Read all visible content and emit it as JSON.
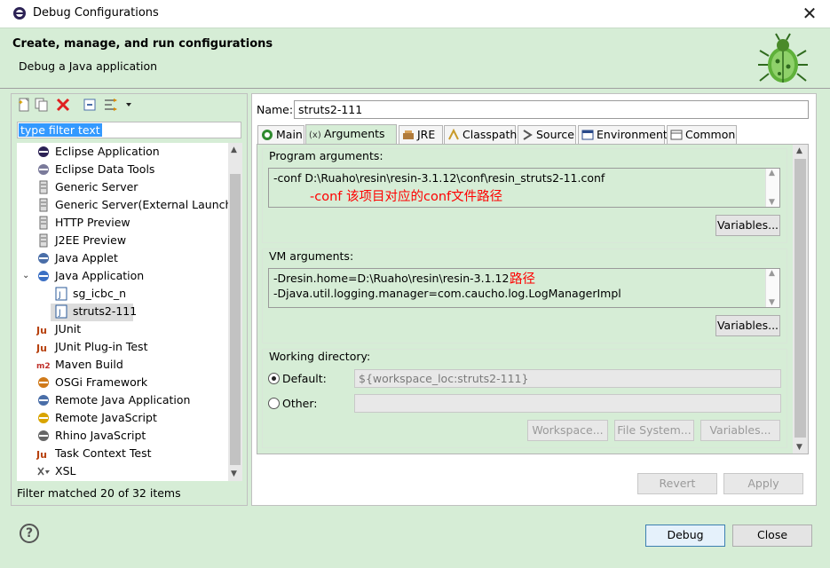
{
  "window": {
    "title": "Debug Configurations",
    "close_glyph": "✕"
  },
  "banner": {
    "title": "Create, manage, and run configurations",
    "subtitle": "Debug a Java application"
  },
  "left": {
    "filter_placeholder": "type filter text",
    "toolbar": [
      "new-config-icon",
      "duplicate-icon",
      "delete-icon",
      "collapse-all-icon",
      "filter-icon",
      "dropdown-icon"
    ],
    "tree": [
      {
        "label": "Eclipse Application",
        "icon": "eclipse-icon"
      },
      {
        "label": "Eclipse Data Tools",
        "icon": "data-tools-icon"
      },
      {
        "label": "Generic Server",
        "icon": "server-icon"
      },
      {
        "label": "Generic Server(External Launch)",
        "icon": "server-icon"
      },
      {
        "label": "HTTP Preview",
        "icon": "server-icon"
      },
      {
        "label": "J2EE Preview",
        "icon": "server-icon"
      },
      {
        "label": "Java Applet",
        "icon": "applet-icon"
      },
      {
        "label": "Java Application",
        "icon": "java-app-icon",
        "expanded": true
      },
      {
        "label": "sg_icbc_n",
        "icon": "java-file-icon",
        "child": true
      },
      {
        "label": "struts2-111",
        "icon": "java-file-icon",
        "child": true,
        "selected": true
      },
      {
        "label": "JUnit",
        "icon": "junit-icon"
      },
      {
        "label": "JUnit Plug-in Test",
        "icon": "junit-plugin-icon"
      },
      {
        "label": "Maven Build",
        "icon": "maven-icon"
      },
      {
        "label": "OSGi Framework",
        "icon": "osgi-icon"
      },
      {
        "label": "Remote Java Application",
        "icon": "remote-java-icon"
      },
      {
        "label": "Remote JavaScript",
        "icon": "remote-js-icon"
      },
      {
        "label": "Rhino JavaScript",
        "icon": "rhino-icon"
      },
      {
        "label": "Task Context Test",
        "icon": "junit-icon"
      },
      {
        "label": "XSL",
        "icon": "xsl-icon"
      }
    ],
    "status": "Filter matched 20 of 32 items"
  },
  "right": {
    "name_label": "Name:",
    "name_value": "struts2-111",
    "tabs": [
      {
        "label": "Main",
        "icon": "main-tab-icon"
      },
      {
        "label": "Arguments",
        "icon": "arguments-tab-icon",
        "active": true
      },
      {
        "label": "JRE",
        "icon": "jre-tab-icon"
      },
      {
        "label": "Classpath",
        "icon": "classpath-tab-icon"
      },
      {
        "label": "Source",
        "icon": "source-tab-icon"
      },
      {
        "label": "Environment",
        "icon": "environment-tab-icon"
      },
      {
        "label": "Common",
        "icon": "common-tab-icon"
      }
    ],
    "program_args": {
      "title": "Program arguments:",
      "value": "-conf D:\\Ruaho\\resin\\resin-3.1.12\\conf\\resin_struts2-11.conf",
      "annotation": "-conf 该项目对应的conf文件路径",
      "variables_label": "Variables..."
    },
    "vm_args": {
      "title": "VM arguments:",
      "line1": "-Dresin.home=D:\\Ruaho\\resin\\resin-3.1.12",
      "line2": "-Djava.util.logging.manager=com.caucho.log.LogManagerImpl",
      "annotation": "路径",
      "variables_label": "Variables..."
    },
    "working_dir": {
      "title": "Working directory:",
      "default_label": "Default:",
      "default_value": "${workspace_loc:struts2-111}",
      "other_label": "Other:",
      "workspace_btn": "Workspace...",
      "filesystem_btn": "File System...",
      "variables_btn": "Variables..."
    },
    "revert_label": "Revert",
    "apply_label": "Apply"
  },
  "footer": {
    "debug_label": "Debug",
    "close_label": "Close",
    "help_glyph": "?"
  }
}
